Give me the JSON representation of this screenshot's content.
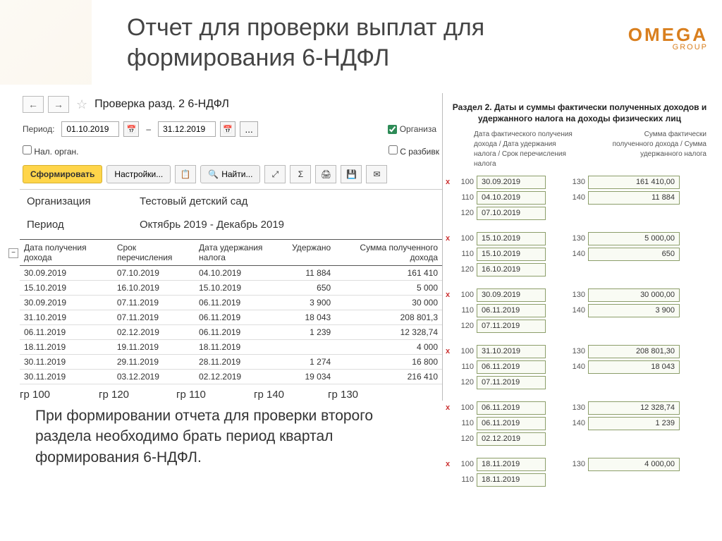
{
  "slide_title": "Отчет для проверки выплат для формирования 6-НДФЛ",
  "logo": {
    "main": "OMEGA",
    "sub": "GROUP"
  },
  "window": {
    "title": "Проверка разд. 2 6-НДФЛ"
  },
  "period": {
    "label": "Период:",
    "from": "01.10.2019",
    "to": "31.12.2019"
  },
  "org_check": "Организа",
  "nal_org": "Нал. орган.",
  "razb": "С разбивк",
  "toolbar": {
    "form": "Сформировать",
    "settings": "Настройки...",
    "find": "Найти..."
  },
  "report": {
    "org_label": "Организация",
    "org_val": "Тестовый детский сад",
    "period_label": "Период",
    "period_val": "Октябрь 2019 - Декабрь 2019",
    "cols": [
      "Дата получения дохода",
      "Срок перечисления",
      "Дата удержания налога",
      "Удержано",
      "Сумма полученного дохода"
    ],
    "rows": [
      [
        "30.09.2019",
        "07.10.2019",
        "04.10.2019",
        "11 884",
        "161 410"
      ],
      [
        "15.10.2019",
        "16.10.2019",
        "15.10.2019",
        "650",
        "5 000"
      ],
      [
        "30.09.2019",
        "07.11.2019",
        "06.11.2019",
        "3 900",
        "30 000"
      ],
      [
        "31.10.2019",
        "07.11.2019",
        "06.11.2019",
        "18 043",
        "208 801,3"
      ],
      [
        "06.11.2019",
        "02.12.2019",
        "06.11.2019",
        "1 239",
        "12 328,74"
      ],
      [
        "18.11.2019",
        "19.11.2019",
        "18.11.2019",
        "",
        "4 000"
      ],
      [
        "30.11.2019",
        "29.11.2019",
        "28.11.2019",
        "1 274",
        "16 800"
      ],
      [
        "30.11.2019",
        "03.12.2019",
        "02.12.2019",
        "19 034",
        "216 410"
      ]
    ],
    "col_labels": [
      "гр 100",
      "гр 120",
      "гр 110",
      "гр 140",
      "гр 130"
    ]
  },
  "note": "При формировании отчета для проверки второго раздела необходимо брать период квартал формирования 6-НДФЛ.",
  "section2": {
    "title": "Раздел 2. Даты и суммы фактически полученных доходов и удержанного налога на доходы физических лиц",
    "col_a": "Дата фактического получения дохода / Дата удержания налога / Срок перечисления налога",
    "col_b": "Сумма фактически полученного дохода / Сумма удержанного налога",
    "groups": [
      {
        "rows": [
          [
            "x",
            "100",
            "30.09.2019",
            "130",
            "161 410,00"
          ],
          [
            "",
            "110",
            "04.10.2019",
            "140",
            "11 884"
          ],
          [
            "",
            "120",
            "07.10.2019",
            "",
            ""
          ]
        ]
      },
      {
        "rows": [
          [
            "x",
            "100",
            "15.10.2019",
            "130",
            "5 000,00"
          ],
          [
            "",
            "110",
            "15.10.2019",
            "140",
            "650"
          ],
          [
            "",
            "120",
            "16.10.2019",
            "",
            ""
          ]
        ]
      },
      {
        "rows": [
          [
            "x",
            "100",
            "30.09.2019",
            "130",
            "30 000,00"
          ],
          [
            "",
            "110",
            "06.11.2019",
            "140",
            "3 900"
          ],
          [
            "",
            "120",
            "07.11.2019",
            "",
            ""
          ]
        ]
      },
      {
        "rows": [
          [
            "x",
            "100",
            "31.10.2019",
            "130",
            "208 801,30"
          ],
          [
            "",
            "110",
            "06.11.2019",
            "140",
            "18 043"
          ],
          [
            "",
            "120",
            "07.11.2019",
            "",
            ""
          ]
        ]
      },
      {
        "rows": [
          [
            "x",
            "100",
            "06.11.2019",
            "130",
            "12 328,74"
          ],
          [
            "",
            "110",
            "06.11.2019",
            "140",
            "1 239"
          ],
          [
            "",
            "120",
            "02.12.2019",
            "",
            ""
          ]
        ]
      },
      {
        "rows": [
          [
            "x",
            "100",
            "18.11.2019",
            "130",
            "4 000,00"
          ],
          [
            "",
            "110",
            "18.11.2019",
            "",
            ""
          ]
        ]
      }
    ]
  }
}
